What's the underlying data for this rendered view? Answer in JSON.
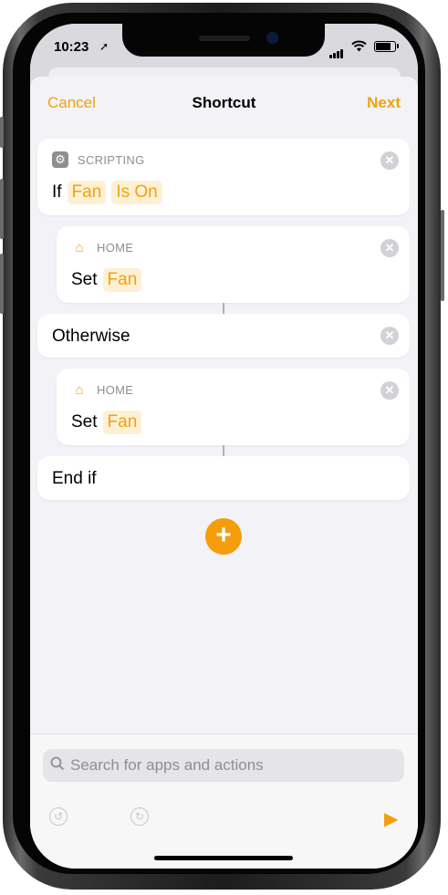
{
  "status_bar": {
    "time": "10:23",
    "location_glyph": "➚"
  },
  "nav": {
    "cancel": "Cancel",
    "title": "Shortcut",
    "next": "Next"
  },
  "actions": [
    {
      "category": "SCRIPTING",
      "icon": "gear-icon",
      "line": [
        "If",
        "Fan",
        "Is On"
      ]
    },
    {
      "category": "HOME",
      "icon": "house-icon",
      "line": [
        "Set",
        "Fan"
      ]
    },
    {
      "line": [
        "Otherwise"
      ]
    },
    {
      "category": "HOME",
      "icon": "house-icon",
      "line": [
        "Set",
        "Fan"
      ]
    },
    {
      "line": [
        "End if"
      ]
    }
  ],
  "search": {
    "placeholder": "Search for apps and actions"
  },
  "colors": {
    "accent": "#F2A20E",
    "add_button": "#F59D0B",
    "background": "#F2F2F7"
  }
}
